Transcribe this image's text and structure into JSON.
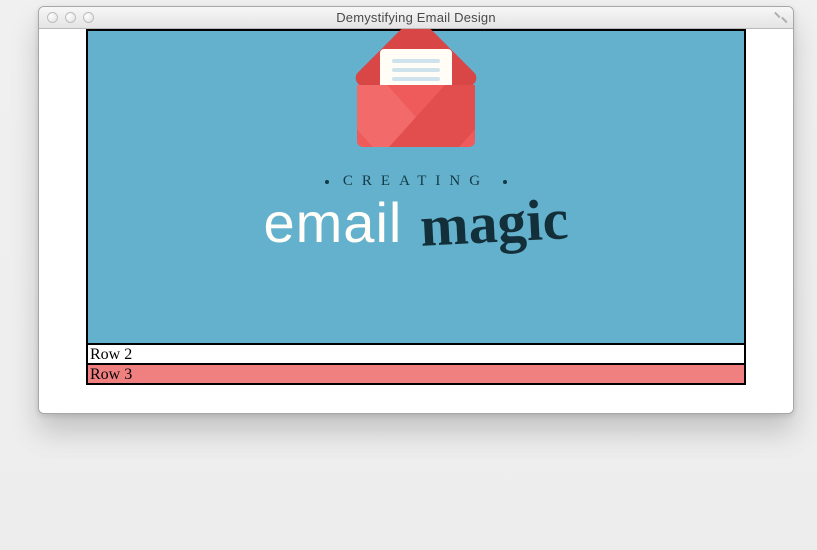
{
  "window": {
    "title": "Demystifying Email Design"
  },
  "hero": {
    "label_top": "CREATING",
    "word1": "email",
    "word2": "magic"
  },
  "rows": {
    "row2": "Row 2",
    "row3": "Row 3"
  },
  "colors": {
    "hero_bg": "#64b1cd",
    "envelope": "#ef5b5b",
    "row3_bg": "#f08080"
  }
}
